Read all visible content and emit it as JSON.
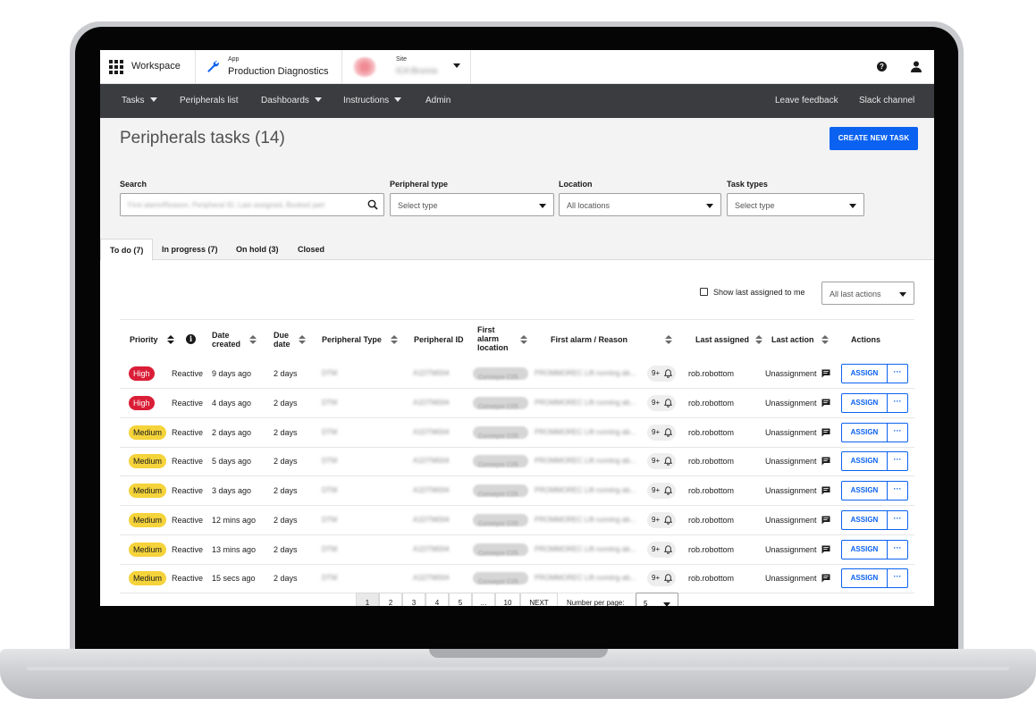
{
  "appbar": {
    "workspace_label": "Workspace",
    "app_caption": "App",
    "app_name": "Production Diagnostics",
    "site_caption": "Site",
    "site_name": "ICA Brunna"
  },
  "nav": {
    "tasks": "Tasks",
    "peripherals_list": "Peripherals list",
    "dashboards": "Dashboards",
    "instructions": "Instructions",
    "admin": "Admin",
    "leave_feedback": "Leave feedback",
    "slack_channel": "Slack channel"
  },
  "page": {
    "title": "Peripherals tasks (14)",
    "create_button": "CREATE NEW TASK"
  },
  "filters": {
    "search_label": "Search",
    "search_placeholder": "First alarm/Reason, Peripheral ID, Last assigned, Booked part",
    "peripheral_type_label": "Peripheral type",
    "peripheral_type_value": "Select type",
    "location_label": "Location",
    "location_value": "All locations",
    "task_types_label": "Task types",
    "task_types_value": "Select type"
  },
  "tabs": [
    {
      "label": "To do (7)"
    },
    {
      "label": "In progress (7)"
    },
    {
      "label": "On hold (3)"
    },
    {
      "label": "Closed"
    }
  ],
  "table_controls": {
    "show_last_assigned": "Show last assigned to me",
    "all_last_actions": "All last actions"
  },
  "columns": {
    "priority": "Priority",
    "date_created_1": "Date",
    "date_created_2": "created",
    "due_date_1": "Due",
    "due_date_2": "date",
    "peripheral_type": "Peripheral Type",
    "peripheral_id": "Peripheral ID",
    "first_alarm_location_1": "First",
    "first_alarm_location_2": "alarm",
    "first_alarm_location_3": "location",
    "first_alarm_reason": "First alarm / Reason",
    "last_assigned": "Last assigned",
    "last_action": "Last action",
    "actions": "Actions"
  },
  "rows": [
    {
      "priority": "High",
      "priority_level": "high",
      "task_type": "Reactive",
      "date_created": "9 days ago",
      "due_date": "2 days",
      "peripheral_type": "DTM",
      "peripheral_id": "A1DTM004",
      "location": "Conveyor C05",
      "reason": "PROMMOREC Lift running ab...",
      "alert_count": "9+",
      "last_assigned": "rob.robottom",
      "last_action": "Unassignment",
      "assign_label": "ASSIGN",
      "more_label": "···"
    },
    {
      "priority": "High",
      "priority_level": "high",
      "task_type": "Reactive",
      "date_created": "4 days ago",
      "due_date": "2 days",
      "peripheral_type": "DTM",
      "peripheral_id": "A1DTM004",
      "location": "Conveyor C05",
      "reason": "PROMMOREC Lift running ab...",
      "alert_count": "9+",
      "last_assigned": "rob.robottom",
      "last_action": "Unassignment",
      "assign_label": "ASSIGN",
      "more_label": "···"
    },
    {
      "priority": "Medium",
      "priority_level": "medium",
      "task_type": "Reactive",
      "date_created": "2 days ago",
      "due_date": "2 days",
      "peripheral_type": "DTM",
      "peripheral_id": "A1DTM004",
      "location": "Conveyor C05",
      "reason": "PROMMOREC Lift running ab...",
      "alert_count": "9+",
      "last_assigned": "rob.robottom",
      "last_action": "Unassignment",
      "assign_label": "ASSIGN",
      "more_label": "···"
    },
    {
      "priority": "Medium",
      "priority_level": "medium",
      "task_type": "Reactive",
      "date_created": "5 days ago",
      "due_date": "2 days",
      "peripheral_type": "DTM",
      "peripheral_id": "A1DTM004",
      "location": "Conveyor C05",
      "reason": "PROMMOREC Lift running ab...",
      "alert_count": "9+",
      "last_assigned": "rob.robottom",
      "last_action": "Unassignment",
      "assign_label": "ASSIGN",
      "more_label": "···"
    },
    {
      "priority": "Medium",
      "priority_level": "medium",
      "task_type": "Reactive",
      "date_created": "3 days ago",
      "due_date": "2 days",
      "peripheral_type": "DTM",
      "peripheral_id": "A1DTM004",
      "location": "Conveyor C05",
      "reason": "PROMMOREC Lift running ab...",
      "alert_count": "9+",
      "last_assigned": "rob.robottom",
      "last_action": "Unassignment",
      "assign_label": "ASSIGN",
      "more_label": "···"
    },
    {
      "priority": "Medium",
      "priority_level": "medium",
      "task_type": "Reactive",
      "date_created": "12 mins ago",
      "due_date": "2 days",
      "peripheral_type": "DTM",
      "peripheral_id": "A1DTM004",
      "location": "Conveyor C05",
      "reason": "PROMMOREC Lift running ab...",
      "alert_count": "9+",
      "last_assigned": "rob.robottom",
      "last_action": "Unassignment",
      "assign_label": "ASSIGN",
      "more_label": "···"
    },
    {
      "priority": "Medium",
      "priority_level": "medium",
      "task_type": "Reactive",
      "date_created": "13 mins ago",
      "due_date": "2 days",
      "peripheral_type": "DTM",
      "peripheral_id": "A1DTM004",
      "location": "Conveyor C05",
      "reason": "PROMMOREC Lift running ab...",
      "alert_count": "9+",
      "last_assigned": "rob.robottom",
      "last_action": "Unassignment",
      "assign_label": "ASSIGN",
      "more_label": "···"
    },
    {
      "priority": "Medium",
      "priority_level": "medium",
      "task_type": "Reactive",
      "date_created": "15 secs ago",
      "due_date": "2 days",
      "peripheral_type": "DTM",
      "peripheral_id": "A1DTM004",
      "location": "Conveyor C05",
      "reason": "PROMMOREC Lift running ab...",
      "alert_count": "9+",
      "last_assigned": "rob.robottom",
      "last_action": "Unassignment",
      "assign_label": "ASSIGN",
      "more_label": "···"
    }
  ],
  "pagination": {
    "pages": [
      "1",
      "2",
      "3",
      "4",
      "5",
      "...",
      "10"
    ],
    "current": "1",
    "next_label": "NEXT",
    "per_page_label": "Number per page:",
    "per_page_value": "5"
  },
  "colors": {
    "accent": "#0b62f0",
    "nav_bg": "#3a3c3f",
    "high": "#da1e37",
    "medium": "#f5d33b"
  },
  "icons": {
    "workspace": "grid-icon",
    "app": "wrench-icon",
    "help": "help-icon",
    "user": "user-icon",
    "search": "search-icon",
    "info": "info-icon",
    "bell": "bell-icon",
    "comment": "comment-icon"
  }
}
